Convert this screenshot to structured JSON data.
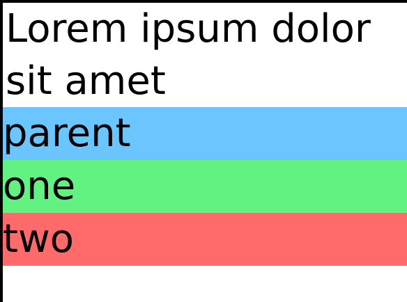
{
  "intro": {
    "text": "Lorem ipsum dolor sit amet"
  },
  "blocks": [
    {
      "label": "parent",
      "color": "#6bc5ff"
    },
    {
      "label": "one",
      "color": "#62f281"
    },
    {
      "label": "two",
      "color": "#ff6b6b"
    }
  ]
}
